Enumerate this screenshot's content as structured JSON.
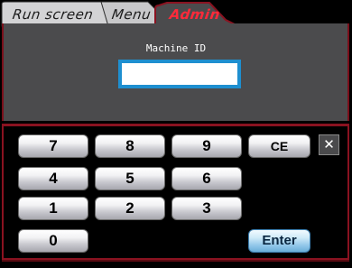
{
  "tabs": [
    {
      "label": "Run screen",
      "active": false
    },
    {
      "label": "Menu",
      "active": false
    },
    {
      "label": "Admin",
      "active": true
    }
  ],
  "machine_id": {
    "label": "Machine ID",
    "value": ""
  },
  "keypad": {
    "keys": {
      "k7": "7",
      "k8": "8",
      "k9": "9",
      "ce": "CE",
      "k4": "4",
      "k5": "5",
      "k6": "6",
      "k1": "1",
      "k2": "2",
      "k3": "3",
      "k0": "0",
      "enter": "Enter"
    },
    "close_label": "✕"
  },
  "colors": {
    "active_tab_text": "#ff2a3a",
    "tab_border": "#8a1220",
    "input_border": "#1e8fd0",
    "panel_bg": "#4b4b4d",
    "enter_key": "#93c8ea"
  },
  "icons": {
    "close": "close-icon"
  }
}
